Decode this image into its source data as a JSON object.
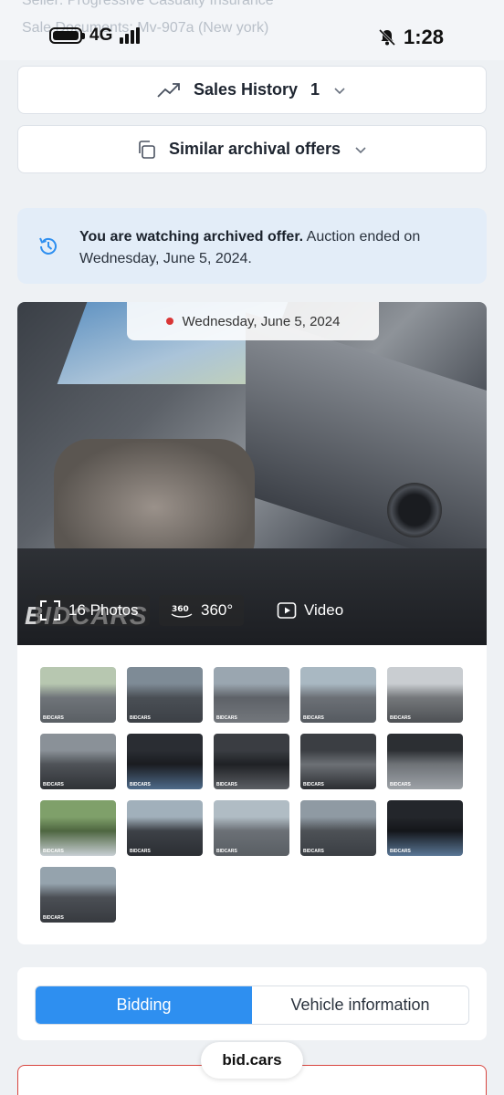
{
  "status_bar": {
    "network": "4G",
    "time": "1:28",
    "ghost_top": "Seller: Progressive Casualty Insurance",
    "ghost_bottom": "Sale Documents: Mv-907a (New york)"
  },
  "sales_history": {
    "label": "Sales History",
    "count": "1"
  },
  "similar_offers": {
    "label": "Similar archival offers"
  },
  "notice": {
    "strong": "You are watching archived offer.",
    "rest": " Auction ended on Wednesday, June 5, 2024."
  },
  "gallery": {
    "date": "Wednesday, June 5, 2024",
    "watermark": "BIDCARS",
    "photos_label": "16 Photos",
    "view_360_label": "360°",
    "video_label": "Video",
    "thumb_tag": "BIDCARS",
    "thumbnails": [
      {
        "name": "thumb-front-left",
        "colors": [
          "#b7c7b0",
          "#6f7479",
          "#5a5f64"
        ]
      },
      {
        "name": "thumb-front-right",
        "colors": [
          "#7e8b96",
          "#4a4f55",
          "#3c4046"
        ]
      },
      {
        "name": "thumb-rear-left",
        "colors": [
          "#9aa6b0",
          "#5e6268",
          "#73777c"
        ]
      },
      {
        "name": "thumb-side",
        "colors": [
          "#a9b8c2",
          "#6c7076",
          "#555a60"
        ]
      },
      {
        "name": "thumb-interior",
        "colors": [
          "#c9cdd1",
          "#75787b",
          "#4d5054"
        ]
      },
      {
        "name": "thumb-front-damage",
        "colors": [
          "#8a9198",
          "#4f5358",
          "#2f3236"
        ]
      },
      {
        "name": "thumb-dashboard",
        "colors": [
          "#2a2d33",
          "#1a1c20",
          "#4f6b8a"
        ]
      },
      {
        "name": "thumb-seat",
        "colors": [
          "#3a3d42",
          "#1f2125",
          "#5c5f64"
        ]
      },
      {
        "name": "thumb-label",
        "colors": [
          "#3b3e43",
          "#6c7075",
          "#2b2d31"
        ]
      },
      {
        "name": "thumb-engine",
        "colors": [
          "#2c2f33",
          "#6e7277",
          "#9da2a7"
        ]
      },
      {
        "name": "thumb-key",
        "colors": [
          "#7fa06a",
          "#4e6640",
          "#c8cfd4"
        ]
      },
      {
        "name": "thumb-front",
        "colors": [
          "#a1b0bb",
          "#3d4147",
          "#2b2e33"
        ]
      },
      {
        "name": "thumb-side-left",
        "colors": [
          "#b0bcc4",
          "#6b7076",
          "#595e63"
        ]
      },
      {
        "name": "thumb-side-right",
        "colors": [
          "#8f9aa3",
          "#4d5156",
          "#3a3e43"
        ]
      },
      {
        "name": "thumb-odometer",
        "colors": [
          "#23262b",
          "#14161a",
          "#5a7796"
        ]
      },
      {
        "name": "thumb-rear",
        "colors": [
          "#95a3ad",
          "#4b4f55",
          "#373a3f"
        ]
      }
    ]
  },
  "tabs": [
    {
      "label": "Bidding",
      "active": true
    },
    {
      "label": "Vehicle information",
      "active": false
    }
  ],
  "browser": {
    "url": "bid.cars"
  },
  "colors": {
    "accent": "#2e8ff0",
    "notice_bg": "#e3edf8",
    "danger": "#d8453f"
  }
}
